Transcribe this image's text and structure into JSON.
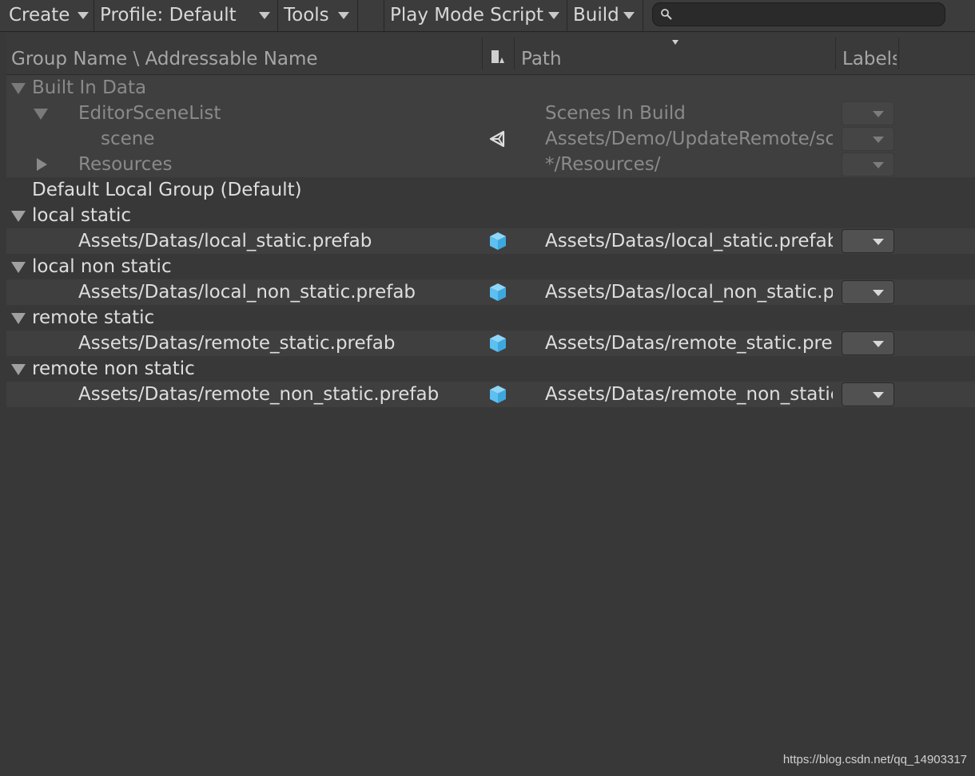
{
  "toolbar": {
    "create": "Create",
    "profile": "Profile: Default",
    "tools": "Tools",
    "play_mode_script": "Play Mode Script",
    "build": "Build",
    "search_placeholder": ""
  },
  "columns": {
    "name": "Group Name \\ Addressable Name",
    "path": "Path",
    "labels": "Labels"
  },
  "rows": [
    {
      "name": "Built In Data",
      "path": "",
      "icon": "",
      "foldout": "open",
      "dim": true,
      "dropdown": false
    },
    {
      "name": "EditorSceneList",
      "path": "Scenes In Build",
      "icon": "",
      "foldout": "open",
      "dim": true,
      "dropdown": "disabled"
    },
    {
      "name": "scene",
      "path": "Assets/Demo/UpdateRemote/scene.unity",
      "icon": "unity-scene-icon",
      "foldout": "",
      "dim": true,
      "dropdown": "disabled"
    },
    {
      "name": "Resources",
      "path": "*/Resources/",
      "icon": "",
      "foldout": "closed",
      "dim": true,
      "dropdown": "disabled"
    },
    {
      "name": "Default Local Group (Default)",
      "path": "",
      "icon": "",
      "foldout": "",
      "dim": false,
      "dropdown": false
    },
    {
      "name": "local static",
      "path": "",
      "icon": "",
      "foldout": "open",
      "dim": false,
      "dropdown": false
    },
    {
      "name": "Assets/Datas/local_static.prefab",
      "path": "Assets/Datas/local_static.prefab",
      "icon": "prefab-cube-icon",
      "foldout": "",
      "dim": false,
      "dropdown": "enabled"
    },
    {
      "name": "local non static",
      "path": "",
      "icon": "",
      "foldout": "open",
      "dim": false,
      "dropdown": false
    },
    {
      "name": "Assets/Datas/local_non_static.prefab",
      "path": "Assets/Datas/local_non_static.prefab",
      "icon": "prefab-cube-icon",
      "foldout": "",
      "dim": false,
      "dropdown": "enabled"
    },
    {
      "name": "remote static",
      "path": "",
      "icon": "",
      "foldout": "open",
      "dim": false,
      "dropdown": false
    },
    {
      "name": "Assets/Datas/remote_static.prefab",
      "path": "Assets/Datas/remote_static.prefab",
      "icon": "prefab-cube-icon",
      "foldout": "",
      "dim": false,
      "dropdown": "enabled"
    },
    {
      "name": "remote non static",
      "path": "",
      "icon": "",
      "foldout": "open",
      "dim": false,
      "dropdown": false
    },
    {
      "name": "Assets/Datas/remote_non_static.prefab",
      "path": "Assets/Datas/remote_non_static.prefab",
      "icon": "prefab-cube-icon",
      "foldout": "",
      "dim": false,
      "dropdown": "enabled"
    }
  ],
  "watermark": "https://blog.csdn.net/qq_14903317",
  "colors": {
    "background": "#383838",
    "prefab_icon": "#5cc0f2",
    "text": "#dedede",
    "dim_text": "#8a8a8a"
  }
}
